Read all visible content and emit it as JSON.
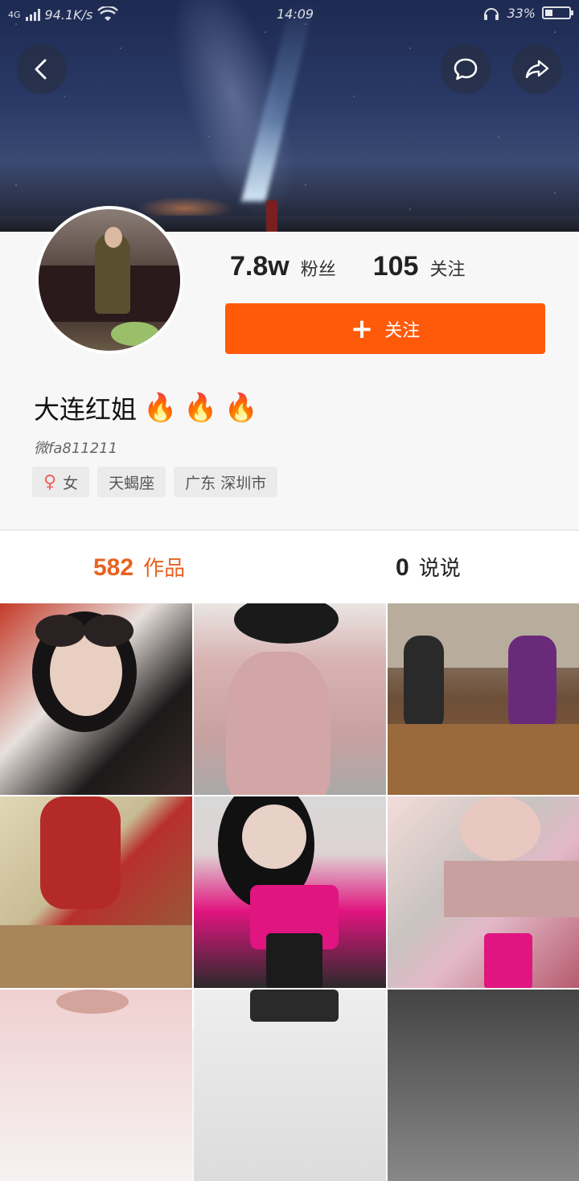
{
  "status_bar": {
    "network": "4G",
    "speed": "94.1K/s",
    "time": "14:09",
    "battery": "33%",
    "battery_level": 0.33
  },
  "header": {
    "back_icon": "chevron-left-icon",
    "message_icon": "chat-bubble-icon",
    "share_icon": "share-arrow-icon"
  },
  "profile": {
    "followers_count": "7.8w",
    "followers_label": "粉丝",
    "following_count": "105",
    "following_label": "关注",
    "follow_button_label": "关注",
    "nickname": "大连红姐",
    "nickname_emojis": [
      "🔥",
      "🔥",
      "🔥"
    ],
    "handle": "微fa811211",
    "tags": {
      "gender_icon": "female-icon",
      "gender": "女",
      "zodiac": "天蝎座",
      "location": "广东 深圳市"
    }
  },
  "tabs": {
    "works_count": "582",
    "works_label": "作品",
    "posts_count": "0",
    "posts_label": "说说"
  },
  "colors": {
    "accent": "#ff5a0a",
    "tab_active": "#e8621f",
    "background": "#f7f7f7"
  }
}
